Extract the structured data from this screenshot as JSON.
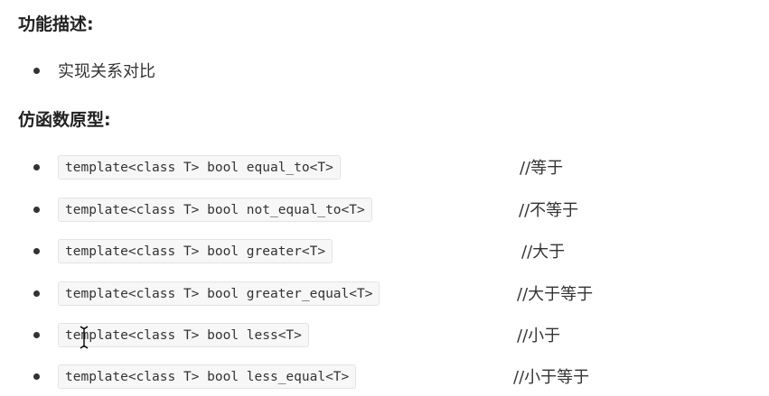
{
  "sections": {
    "description_heading": "功能描述:",
    "description_items": [
      "实现关系对比"
    ],
    "prototype_heading": "仿函数原型:"
  },
  "prototypes": [
    {
      "code": "template<class T> bool equal_to<T>",
      "comment": "//等于"
    },
    {
      "code": "template<class T> bool not_equal_to<T>",
      "comment": "//不等于"
    },
    {
      "code": "template<class T> bool greater<T>",
      "comment": "//大于"
    },
    {
      "code": "template<class T> bool greater_equal<T>",
      "comment": "//大于等于"
    },
    {
      "code": "template<class T> bool less<T>",
      "comment": "//小于"
    },
    {
      "code": "template<class T> bool less_equal<T>",
      "comment": "//小于等于"
    }
  ],
  "icons": {
    "cursor": "text-cursor-icon"
  }
}
